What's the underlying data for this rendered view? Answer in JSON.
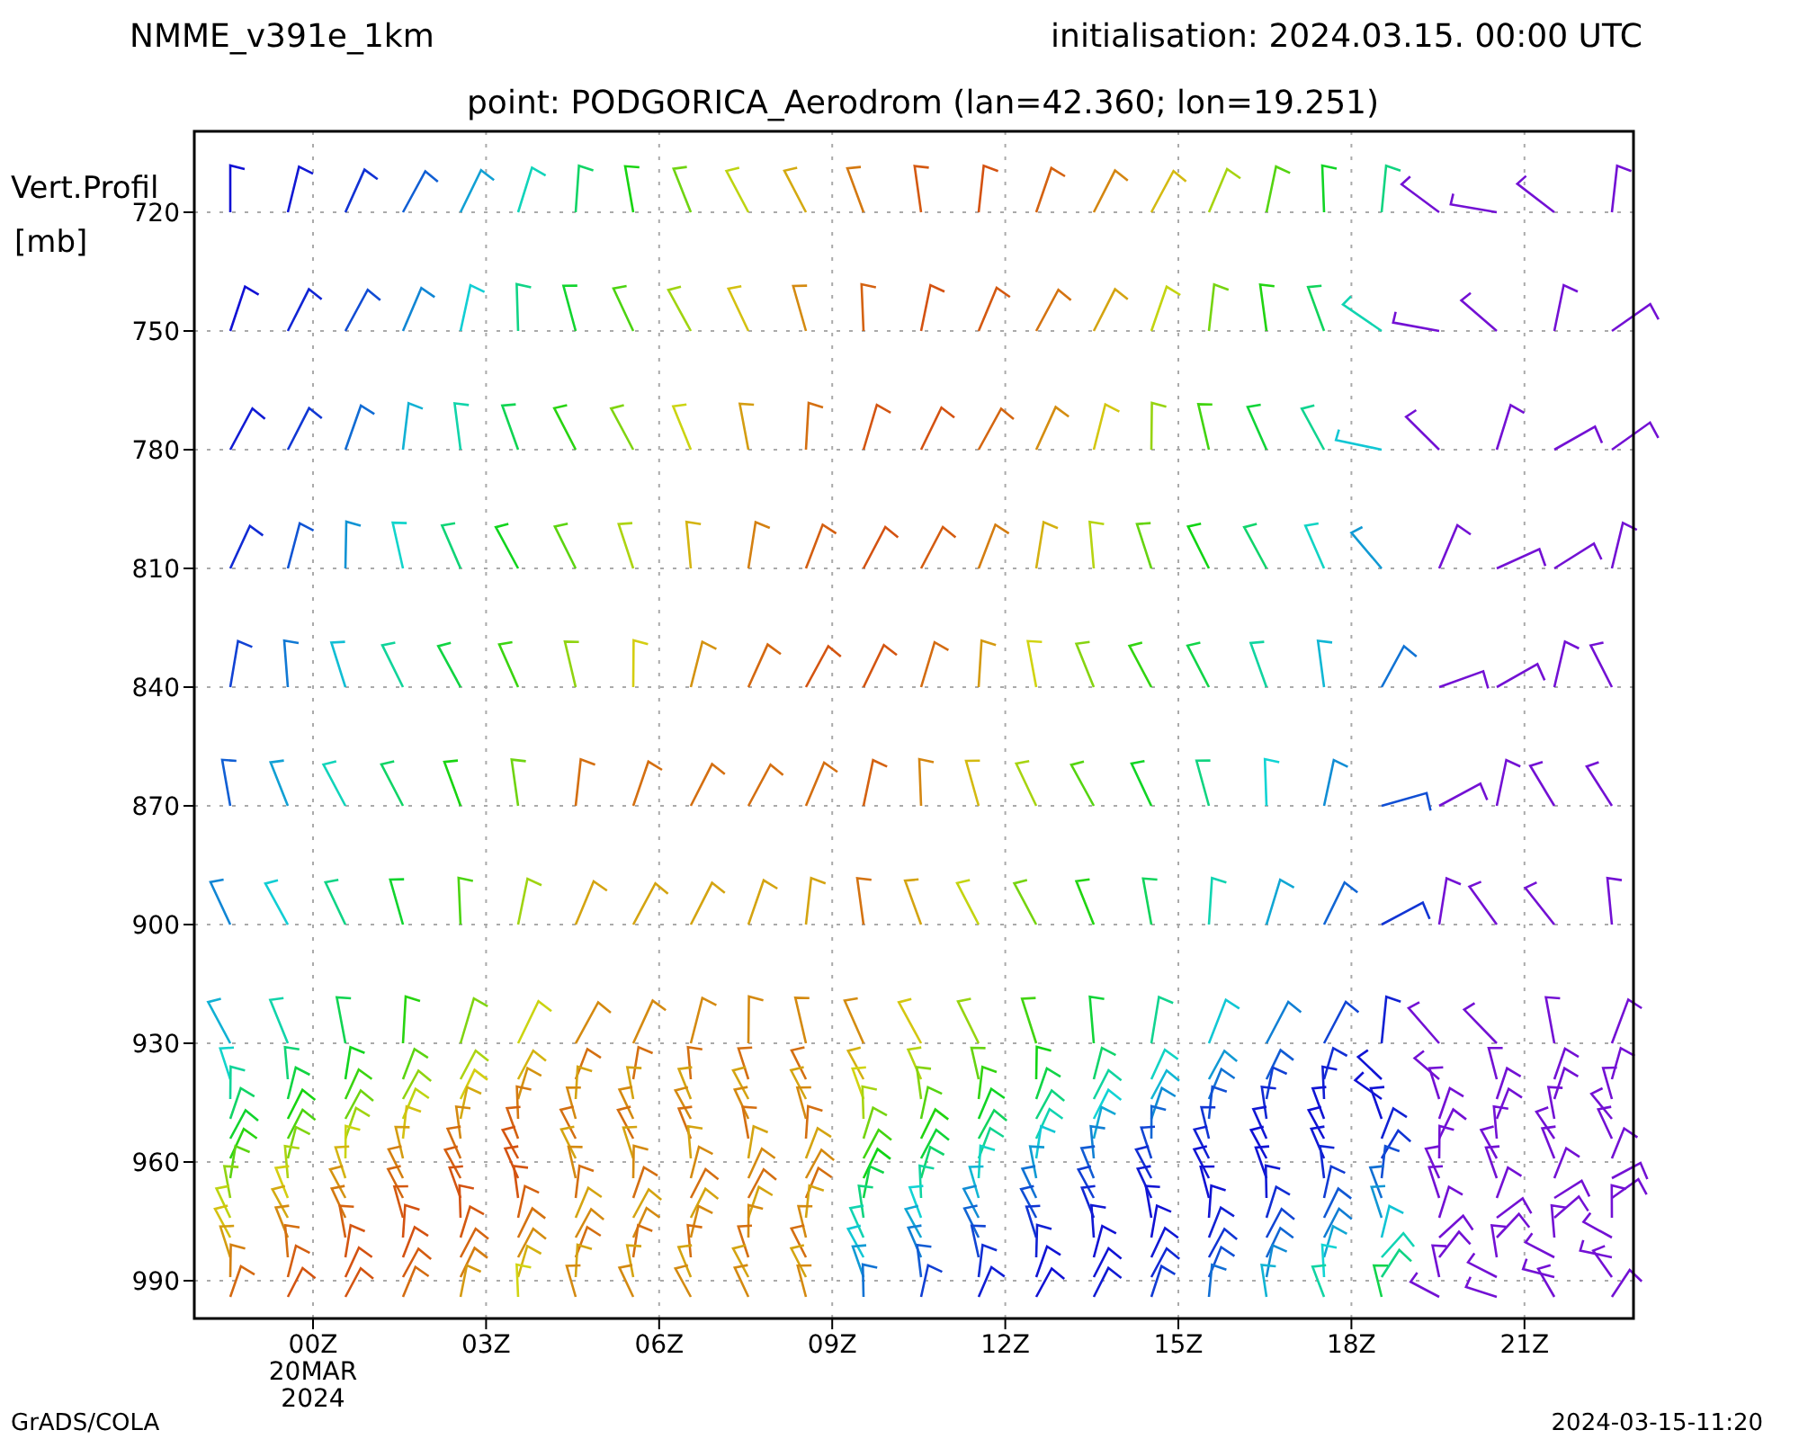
{
  "header": {
    "model": "NMME_v391e_1km",
    "initialisation": "initialisation: 2024.03.15. 00:00 UTC",
    "point": "point: PODGORICA_Aerodrom (lan=42.360; lon=19.251)"
  },
  "chart": {
    "ylabel": [
      "Vert.Profil",
      "[mb]"
    ],
    "yticks": [
      "720",
      "750",
      "780",
      "810",
      "840",
      "870",
      "900",
      "930",
      "960",
      "990"
    ],
    "xticks": [
      "00Z",
      "03Z",
      "06Z",
      "09Z",
      "12Z",
      "15Z",
      "18Z",
      "21Z"
    ],
    "xtick_date": [
      "20MAR",
      "2024"
    ]
  },
  "footer": {
    "left": "GrADS/COLA",
    "right": "2024-03-15-11:20"
  }
}
